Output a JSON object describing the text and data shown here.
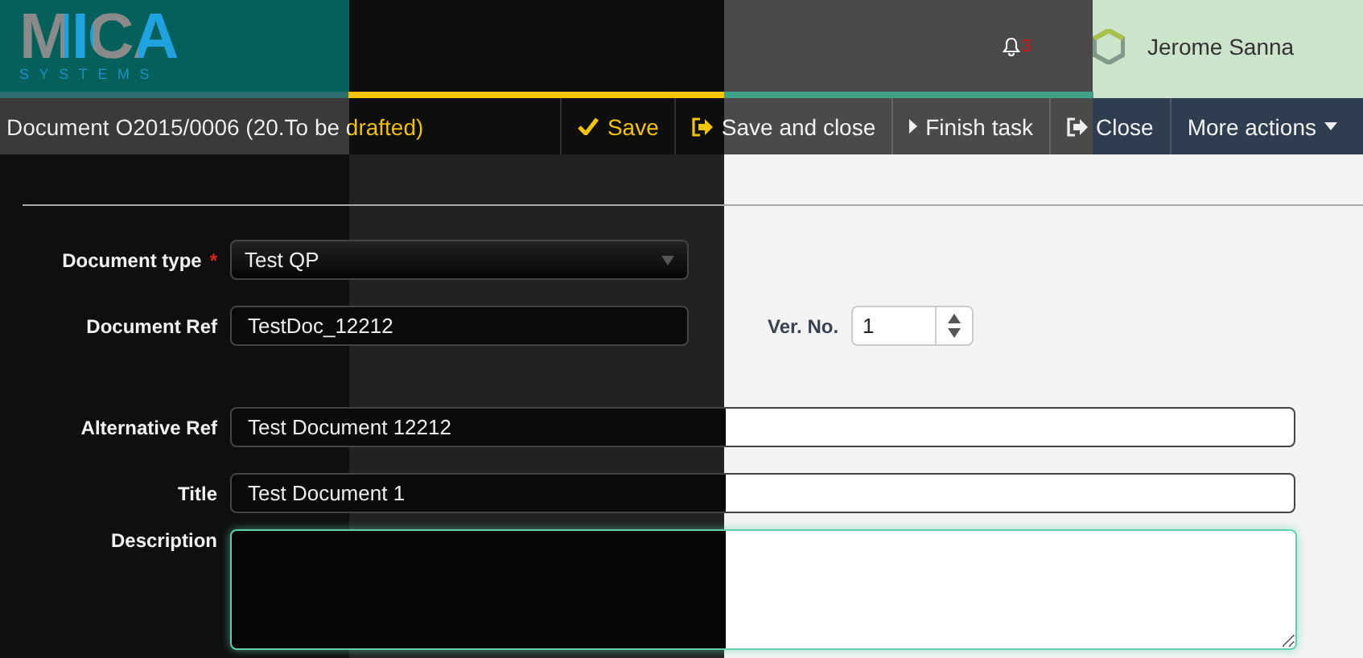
{
  "header": {
    "logo": {
      "word": "MICA",
      "tagline": "SYSTEMS"
    },
    "notifications": {
      "count": "3"
    },
    "user": {
      "name": "Jerome Sanna"
    }
  },
  "toolbar": {
    "title": "Document O2015/0006 (20.To be drafted)",
    "actions": [
      {
        "kind": "save",
        "label": "Save"
      },
      {
        "kind": "save-close",
        "label": "Save and close"
      },
      {
        "kind": "finish",
        "label": "Finish task"
      },
      {
        "kind": "close",
        "label": "Close"
      },
      {
        "kind": "more",
        "label": "More actions"
      }
    ]
  },
  "form": {
    "document_type": {
      "label": "Document type",
      "required_marker": "*",
      "value": "Test QP"
    },
    "document_ref": {
      "label": "Document Ref",
      "value": "TestDoc_12212"
    },
    "version": {
      "label": "Ver. No.",
      "value": "1"
    },
    "alternative_ref": {
      "label": "Alternative Ref",
      "value": "Test Document 12212"
    },
    "title": {
      "label": "Title",
      "value": "Test Document 1"
    },
    "description": {
      "label": "Description"
    }
  }
}
